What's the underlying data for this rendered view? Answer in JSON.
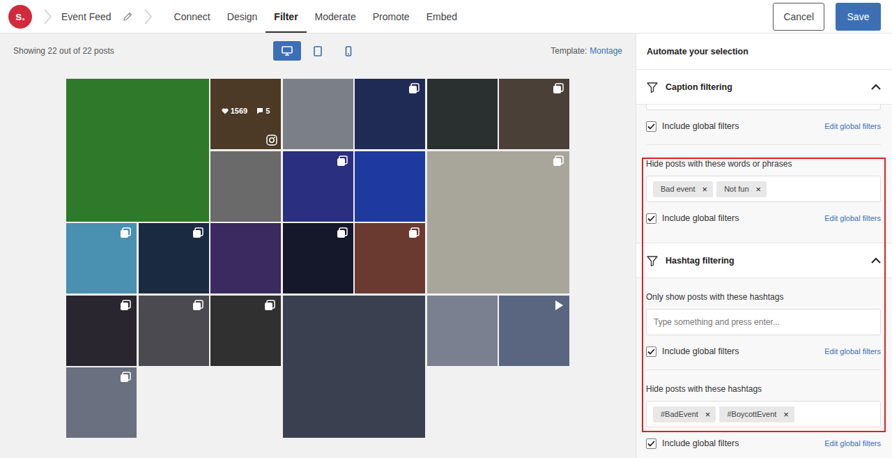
{
  "app": {
    "logo": "s."
  },
  "breadcrumb": {
    "feed_name": "Event Feed"
  },
  "tabs": [
    {
      "label": "Connect",
      "selected": false
    },
    {
      "label": "Design",
      "selected": false
    },
    {
      "label": "Filter",
      "selected": true
    },
    {
      "label": "Moderate",
      "selected": false
    },
    {
      "label": "Promote",
      "selected": false
    },
    {
      "label": "Embed",
      "selected": false
    }
  ],
  "buttons": {
    "cancel": "Cancel",
    "save": "Save"
  },
  "preview": {
    "count": "Showing 22 out of 22 posts",
    "devices": [
      {
        "kind": "desktop",
        "selected": true
      },
      {
        "kind": "tablet",
        "selected": false
      },
      {
        "kind": "phone",
        "selected": false
      }
    ],
    "template_label": "Template:",
    "template": "Montage",
    "posts": [
      {
        "kind": "image",
        "hovered": false,
        "color": "#2f7a2a"
      },
      {
        "kind": "image",
        "hovered": true,
        "likes": "1569",
        "comments": "5",
        "color": "#8a6a45"
      },
      {
        "kind": "image",
        "hovered": false,
        "color": "#7a7f88"
      },
      {
        "kind": "carousel",
        "hovered": false,
        "color": "#1f2a55"
      },
      {
        "kind": "image",
        "hovered": false,
        "color": "#2a3030"
      },
      {
        "kind": "carousel",
        "hovered": false,
        "color": "#4a4038"
      },
      {
        "kind": "image",
        "hovered": false,
        "color": "#6a6a6a"
      },
      {
        "kind": "carousel",
        "hovered": false,
        "color": "#2a2f80"
      },
      {
        "kind": "image",
        "hovered": false,
        "color": "#1e3aa0"
      },
      {
        "kind": "carousel",
        "hovered": false,
        "color": "#a8a59a"
      },
      {
        "kind": "carousel",
        "hovered": false,
        "color": "#4a90b0"
      },
      {
        "kind": "carousel",
        "hovered": false,
        "color": "#1a2a40"
      },
      {
        "kind": "image",
        "hovered": false,
        "color": "#3a2a60"
      },
      {
        "kind": "carousel",
        "hovered": false,
        "color": "#15182a"
      },
      {
        "kind": "carousel",
        "hovered": false,
        "color": "#6a3a30"
      },
      {
        "kind": "carousel",
        "hovered": false,
        "color": "#2a2630"
      },
      {
        "kind": "carousel",
        "hovered": false,
        "color": "#4a4a50"
      },
      {
        "kind": "carousel",
        "hovered": false,
        "color": "#303030"
      },
      {
        "kind": "image",
        "hovered": false,
        "color": "#3a4050"
      },
      {
        "kind": "image",
        "hovered": false,
        "color": "#7a8090"
      },
      {
        "kind": "video",
        "hovered": false,
        "color": "#5a6580"
      },
      {
        "kind": "carousel",
        "hovered": false,
        "color": "#6a7080"
      }
    ]
  },
  "panel": {
    "title": "Automate your selection",
    "highlight": true,
    "tag_remove": "×",
    "sections": [
      {
        "title": "Caption filtering",
        "expanded": true,
        "fields": [
          {
            "kind": "cut",
            "tags": [],
            "include_global": {
              "label": "Include global filters",
              "checked": true
            },
            "edit_link": "Edit global filters"
          },
          {
            "kind": "tags",
            "label": "Hide posts with these words or phrases",
            "tags": [
              "Bad event",
              "Not fun"
            ],
            "include_global": {
              "label": "Include global filters",
              "checked": true
            },
            "edit_link": "Edit global filters"
          }
        ]
      },
      {
        "title": "Hashtag filtering",
        "expanded": true,
        "fields": [
          {
            "kind": "tags",
            "label": "Only show posts with these hashtags",
            "tags": [],
            "placeholder": "Type something and press enter...",
            "include_global": {
              "label": "Include global filters",
              "checked": true
            },
            "edit_link": "Edit global filters"
          },
          {
            "kind": "tags",
            "label": "Hide posts with these hashtags",
            "tags": [
              "#BadEvent",
              "#BoycottEvent"
            ],
            "include_global": {
              "label": "Include global filters",
              "checked": true
            },
            "edit_link": "Edit global filters"
          }
        ]
      }
    ]
  }
}
